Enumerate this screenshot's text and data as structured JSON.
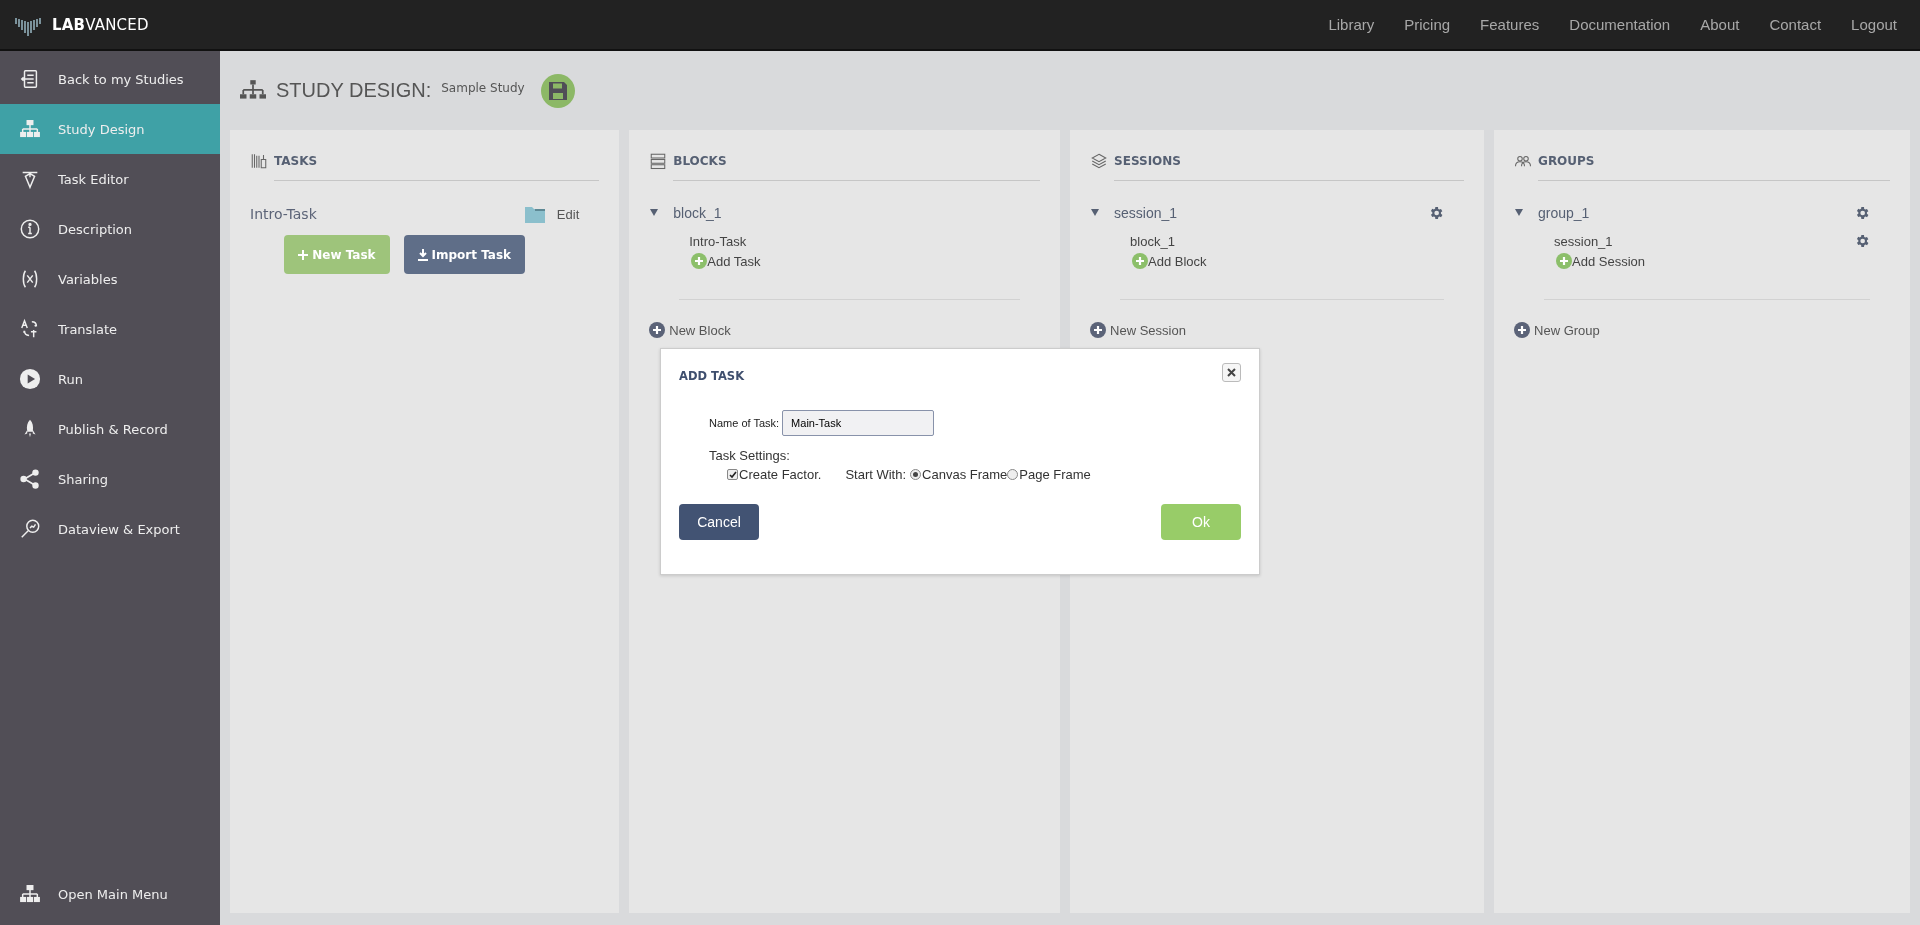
{
  "brand": "**LAB**VANCED",
  "nav": [
    "Library",
    "Pricing",
    "Features",
    "Documentation",
    "About",
    "Contact",
    "Logout"
  ],
  "sidebar": {
    "items": [
      {
        "label": "Back to my Studies",
        "selected": false
      },
      {
        "label": "Study Design",
        "selected": true
      },
      {
        "label": "Task Editor",
        "selected": false
      },
      {
        "label": "Description",
        "selected": false
      },
      {
        "label": "Variables",
        "selected": false
      },
      {
        "label": "Translate",
        "selected": false
      },
      {
        "label": "Run",
        "selected": false
      },
      {
        "label": "Publish & Record",
        "selected": false
      },
      {
        "label": "Sharing",
        "selected": false
      },
      {
        "label": "Dataview & Export",
        "selected": false
      }
    ],
    "footer": {
      "label": "Open Main Menu"
    }
  },
  "header": {
    "title": "STUDY DESIGN:",
    "study": "Sample Study"
  },
  "columns": [
    {
      "kind": "tasks",
      "title": "TASKS",
      "tasks": [
        {
          "name": "Intro-Task",
          "action": "Edit"
        }
      ],
      "buttons": [
        {
          "label": "New Task",
          "kind": "new"
        },
        {
          "label": "Import Task",
          "kind": "import"
        }
      ]
    },
    {
      "kind": "tree",
      "title": "BLOCKS",
      "items": [
        {
          "name": "block_1",
          "expanded": true,
          "settings": false,
          "children": [
            {
              "name": "Intro-Task",
              "settings": false
            }
          ],
          "add": "Add Task"
        }
      ],
      "new": "New Block"
    },
    {
      "kind": "tree",
      "title": "SESSIONS",
      "items": [
        {
          "name": "session_1",
          "expanded": true,
          "settings": true,
          "children": [
            {
              "name": "block_1",
              "settings": false
            }
          ],
          "add": "Add Block"
        }
      ],
      "new": "New Session"
    },
    {
      "kind": "tree",
      "title": "GROUPS",
      "items": [
        {
          "name": "group_1",
          "expanded": true,
          "settings": true,
          "children": [
            {
              "name": "session_1",
              "settings": true
            }
          ],
          "add": "Add Session"
        }
      ],
      "new": "New Group"
    }
  ],
  "dialog": {
    "title": "ADD TASK",
    "name_label": "Name of Task:",
    "name_value": "Main-Task",
    "settings_label": "Task Settings:",
    "create_factor": {
      "label": "Create Factor.",
      "checked": true
    },
    "start_label": "Start With:",
    "start_options": [
      {
        "label": "Canvas Frame",
        "selected": true
      },
      {
        "label": "Page Frame",
        "selected": false
      }
    ],
    "cancel": "Cancel",
    "ok": "Ok"
  }
}
